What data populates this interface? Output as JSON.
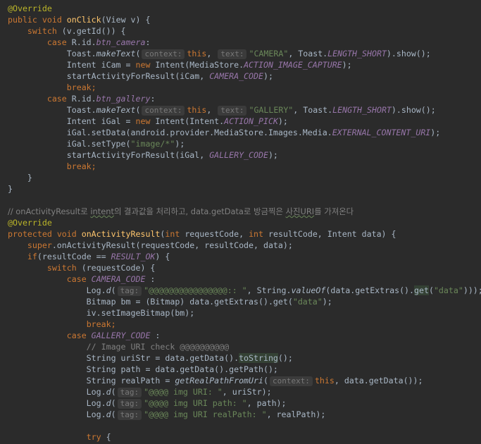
{
  "code_lines": [
    [
      {
        "t": "@Override",
        "c": "ann"
      }
    ],
    [
      {
        "t": "public",
        "c": "kw"
      },
      {
        "t": " "
      },
      {
        "t": "void",
        "c": "kw"
      },
      {
        "t": " "
      },
      {
        "t": "onClick",
        "c": "fn"
      },
      {
        "t": "(View v) {"
      }
    ],
    [
      {
        "t": "    "
      },
      {
        "t": "switch",
        "c": "kw"
      },
      {
        "t": " (v.getId()) {"
      }
    ],
    [
      {
        "t": "        "
      },
      {
        "t": "case",
        "c": "kw"
      },
      {
        "t": " R.id."
      },
      {
        "t": "btn_camera",
        "c": "field"
      },
      {
        "t": ":"
      }
    ],
    [
      {
        "t": "            Toast."
      },
      {
        "t": "makeText",
        "c": "sm"
      },
      {
        "t": "("
      },
      {
        "t": "context:",
        "c": "hint"
      },
      {
        "t": "this",
        "c": "kw"
      },
      {
        "t": ", "
      },
      {
        "t": "text:",
        "c": "hint"
      },
      {
        "t": "\"CAMERA\"",
        "c": "str"
      },
      {
        "t": ", Toast."
      },
      {
        "t": "LENGTH_SHORT",
        "c": "field"
      },
      {
        "t": ").show();"
      }
    ],
    [
      {
        "t": "            Intent iCam = "
      },
      {
        "t": "new",
        "c": "kw"
      },
      {
        "t": " Intent(MediaStore."
      },
      {
        "t": "ACTION_IMAGE_CAPTURE",
        "c": "field"
      },
      {
        "t": ");"
      }
    ],
    [
      {
        "t": "            startActivityForResult(iCam, "
      },
      {
        "t": "CAMERA_CODE",
        "c": "field"
      },
      {
        "t": ");"
      }
    ],
    [
      {
        "t": "            "
      },
      {
        "t": "break",
        "c": "kw"
      },
      {
        "t": ";",
        "c": "kw"
      }
    ],
    [
      {
        "t": "        "
      },
      {
        "t": "case",
        "c": "kw"
      },
      {
        "t": " R.id."
      },
      {
        "t": "btn_gallery",
        "c": "field"
      },
      {
        "t": ":"
      }
    ],
    [
      {
        "t": "            Toast."
      },
      {
        "t": "makeText",
        "c": "sm"
      },
      {
        "t": "("
      },
      {
        "t": "context:",
        "c": "hint"
      },
      {
        "t": "this",
        "c": "kw"
      },
      {
        "t": ", "
      },
      {
        "t": "text:",
        "c": "hint"
      },
      {
        "t": "\"GALLERY\"",
        "c": "str"
      },
      {
        "t": ", Toast."
      },
      {
        "t": "LENGTH_SHORT",
        "c": "field"
      },
      {
        "t": ").show();"
      }
    ],
    [
      {
        "t": "            Intent iGal = "
      },
      {
        "t": "new",
        "c": "kw"
      },
      {
        "t": " Intent(Intent."
      },
      {
        "t": "ACTION_PICK",
        "c": "field"
      },
      {
        "t": ");"
      }
    ],
    [
      {
        "t": "            iGal.setData(android.provider.MediaStore.Images.Media."
      },
      {
        "t": "EXTERNAL_CONTENT_URI",
        "c": "field"
      },
      {
        "t": ");"
      }
    ],
    [
      {
        "t": "            iGal.setType("
      },
      {
        "t": "\"image/*\"",
        "c": "str"
      },
      {
        "t": ");"
      }
    ],
    [
      {
        "t": "            startActivityForResult(iGal, "
      },
      {
        "t": "GALLERY_CODE",
        "c": "field"
      },
      {
        "t": ");"
      }
    ],
    [
      {
        "t": "            "
      },
      {
        "t": "break",
        "c": "kw"
      },
      {
        "t": ";",
        "c": "kw"
      }
    ],
    [
      {
        "t": "    }"
      }
    ],
    [
      {
        "t": "}"
      }
    ],
    [],
    [
      {
        "t": "// onActivityResult로 ",
        "c": "cm-kr"
      },
      {
        "t": "intent",
        "c": "cm-kr sq"
      },
      {
        "t": "의 결과값을 처리하고, data.getData로 방금찍은 ",
        "c": "cm-kr"
      },
      {
        "t": "사진URI",
        "c": "cm-kr sq"
      },
      {
        "t": "를 가져온다",
        "c": "cm-kr"
      }
    ],
    [
      {
        "t": "@Override",
        "c": "ann"
      }
    ],
    [
      {
        "t": "protected",
        "c": "kw"
      },
      {
        "t": " "
      },
      {
        "t": "void",
        "c": "kw"
      },
      {
        "t": " "
      },
      {
        "t": "onActivityResult",
        "c": "fn"
      },
      {
        "t": "("
      },
      {
        "t": "int",
        "c": "kw"
      },
      {
        "t": " requestCode, "
      },
      {
        "t": "int",
        "c": "kw"
      },
      {
        "t": " resultCode, Intent data) {"
      }
    ],
    [
      {
        "t": "    "
      },
      {
        "t": "super",
        "c": "kw"
      },
      {
        "t": ".onActivityResult(requestCode, resultCode, data);"
      }
    ],
    [
      {
        "t": "    "
      },
      {
        "t": "if",
        "c": "kw"
      },
      {
        "t": "(resultCode == "
      },
      {
        "t": "RESULT_OK",
        "c": "field"
      },
      {
        "t": ") {"
      }
    ],
    [
      {
        "t": "        "
      },
      {
        "t": "switch",
        "c": "kw"
      },
      {
        "t": " (requestCode) {"
      }
    ],
    [
      {
        "t": "            "
      },
      {
        "t": "case",
        "c": "kw"
      },
      {
        "t": " "
      },
      {
        "t": "CAMERA_CODE",
        "c": "field"
      },
      {
        "t": " :"
      }
    ],
    [
      {
        "t": "                Log."
      },
      {
        "t": "d",
        "c": "sm"
      },
      {
        "t": "("
      },
      {
        "t": "tag:",
        "c": "hint"
      },
      {
        "t": "\"@@@@@@@@@@@@@@@@:: \"",
        "c": "str"
      },
      {
        "t": ", String."
      },
      {
        "t": "valueOf",
        "c": "sm"
      },
      {
        "t": "(data.getExtras()."
      },
      {
        "t": "get",
        "c": "hl"
      },
      {
        "t": "("
      },
      {
        "t": "\"data\"",
        "c": "str"
      },
      {
        "t": ")));"
      }
    ],
    [
      {
        "t": "                Bitmap bm = (Bitmap) data.getExtras().get("
      },
      {
        "t": "\"data\"",
        "c": "str"
      },
      {
        "t": ");"
      }
    ],
    [
      {
        "t": "                iv.setImageBitmap(bm);"
      }
    ],
    [
      {
        "t": "                "
      },
      {
        "t": "break",
        "c": "kw"
      },
      {
        "t": ";",
        "c": "kw"
      }
    ],
    [
      {
        "t": "            "
      },
      {
        "t": "case",
        "c": "kw"
      },
      {
        "t": " "
      },
      {
        "t": "GALLERY_CODE",
        "c": "field"
      },
      {
        "t": " :"
      }
    ],
    [
      {
        "t": "                // Image URI check @@@@@@@@@@",
        "c": "cm"
      }
    ],
    [
      {
        "t": "                String uriStr = data.getData()."
      },
      {
        "t": "toString",
        "c": "hl"
      },
      {
        "t": "();"
      }
    ],
    [
      {
        "t": "                String path = data.getData().getPath();"
      }
    ],
    [
      {
        "t": "                String realPath = "
      },
      {
        "t": "getRealPathFromUri",
        "c": "sm"
      },
      {
        "t": "("
      },
      {
        "t": "context:",
        "c": "hint"
      },
      {
        "t": "this",
        "c": "kw"
      },
      {
        "t": ", data.getData());"
      }
    ],
    [
      {
        "t": "                Log."
      },
      {
        "t": "d",
        "c": "sm"
      },
      {
        "t": "("
      },
      {
        "t": "tag:",
        "c": "hint"
      },
      {
        "t": "\"@@@@ img URI: \"",
        "c": "str"
      },
      {
        "t": ", uriStr);"
      }
    ],
    [
      {
        "t": "                Log."
      },
      {
        "t": "d",
        "c": "sm"
      },
      {
        "t": "("
      },
      {
        "t": "tag:",
        "c": "hint"
      },
      {
        "t": "\"@@@@ img URI path: \"",
        "c": "str"
      },
      {
        "t": ", path);"
      }
    ],
    [
      {
        "t": "                Log."
      },
      {
        "t": "d",
        "c": "sm"
      },
      {
        "t": "("
      },
      {
        "t": "tag:",
        "c": "hint"
      },
      {
        "t": "\"@@@@ img URI realPath: \"",
        "c": "str"
      },
      {
        "t": ", realPath);"
      }
    ],
    [],
    [
      {
        "t": "                "
      },
      {
        "t": "try",
        "c": "kw"
      },
      {
        "t": " {"
      }
    ]
  ]
}
